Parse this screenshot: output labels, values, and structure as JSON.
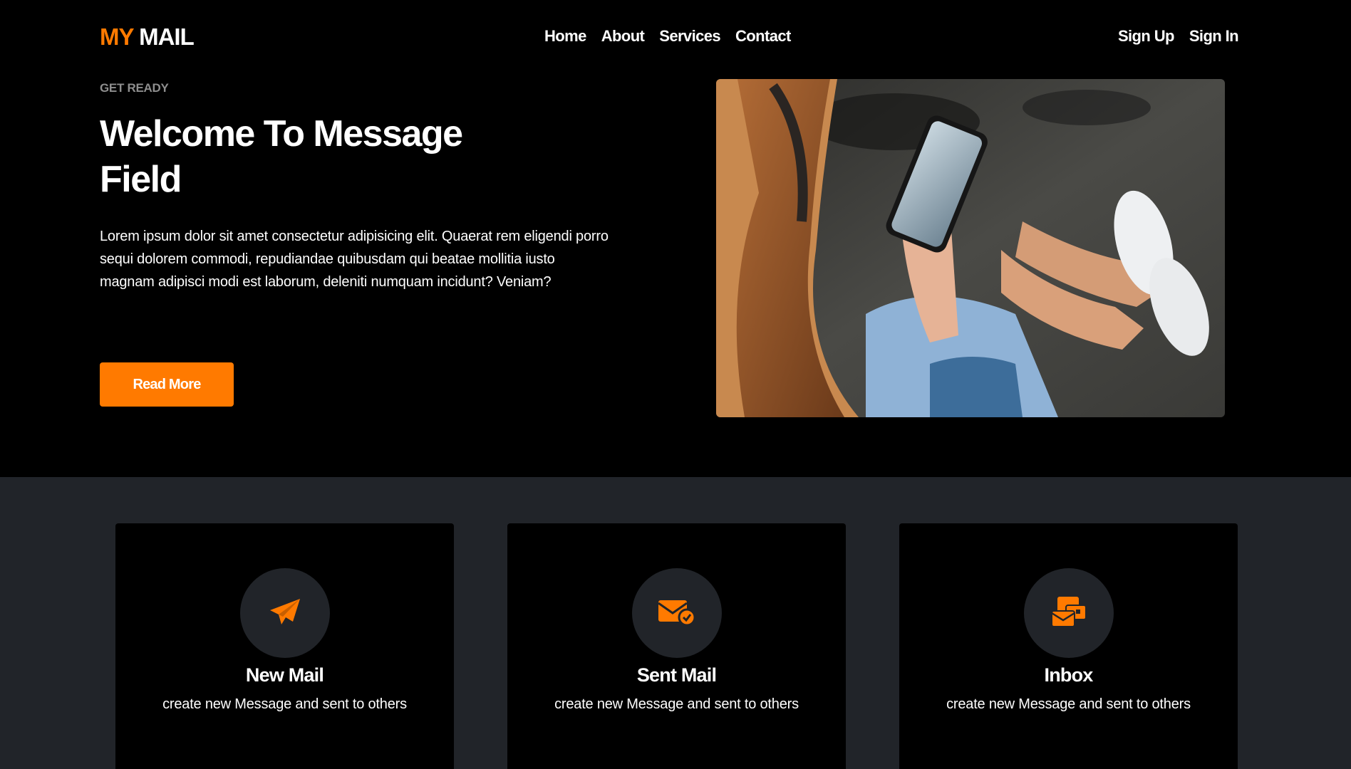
{
  "brand": {
    "part1": "MY",
    "part2": "MAIL",
    "accent_color": "#ff7a00"
  },
  "nav": {
    "links": [
      "Home",
      "About",
      "Services",
      "Contact"
    ],
    "auth": [
      "Sign Up",
      "Sign In"
    ]
  },
  "hero": {
    "eyebrow": "GET READY",
    "title": "Welcome To Message Field",
    "text": "Lorem ipsum dolor sit amet consectetur adipisicing elit. Quaerat rem eligendi porro sequi dolorem commodi, repudiandae quibusdam qui beatae mollitia iusto magnam adipisci modi est laborum, deleniti numquam incidunt? Veniam?",
    "button": "Read More"
  },
  "features": [
    {
      "title": "New Mail",
      "text": "create new Message and sent to others",
      "icon": "paper-plane-icon"
    },
    {
      "title": "Sent Mail",
      "text": "create new Message and sent to others",
      "icon": "envelope-check-icon"
    },
    {
      "title": "Inbox",
      "text": "create new Message and sent to others",
      "icon": "envelopes-icon"
    }
  ]
}
